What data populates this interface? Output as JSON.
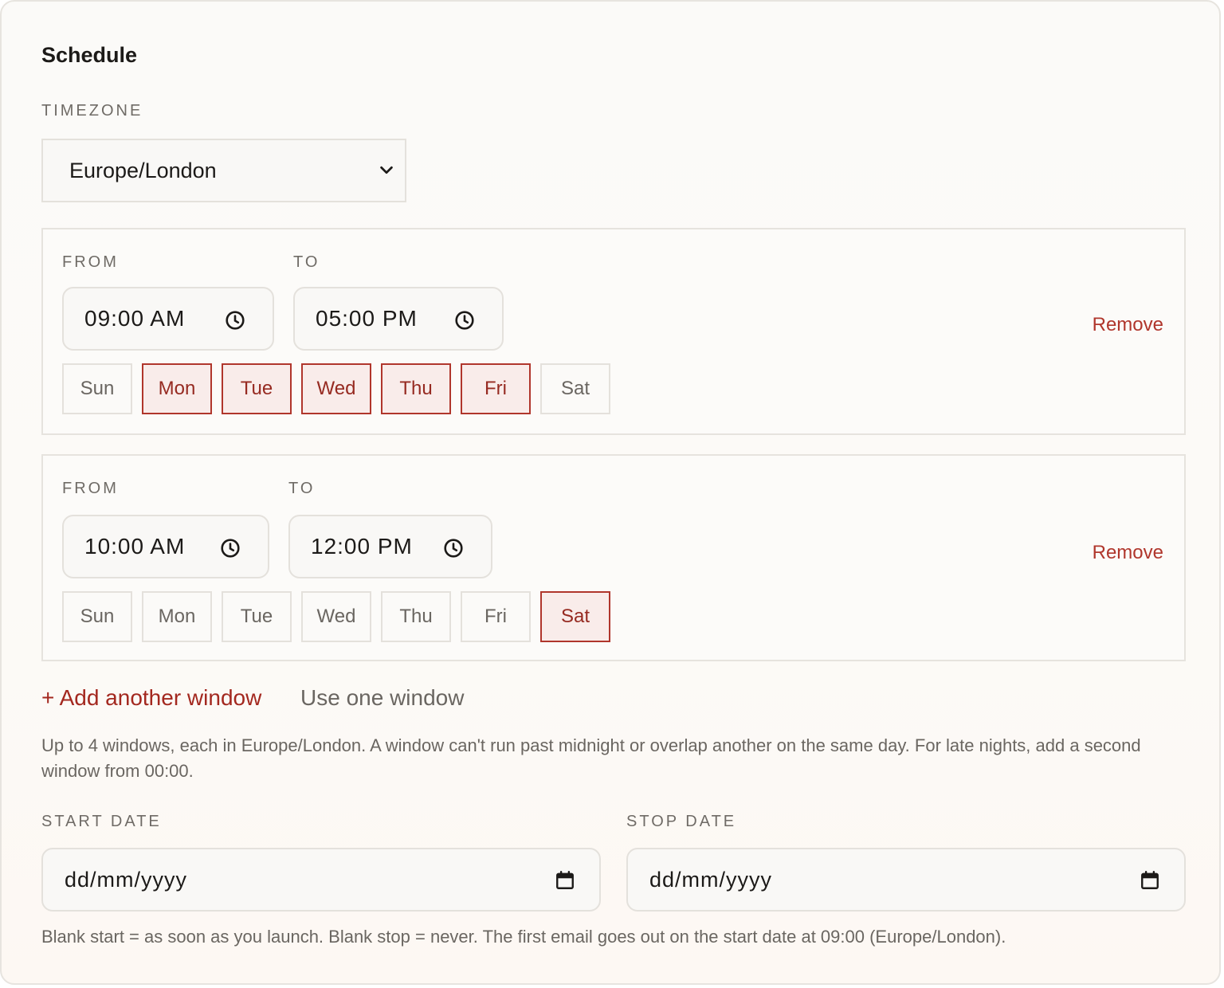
{
  "section": {
    "title": "Schedule"
  },
  "timezone": {
    "label": "TIMEZONE",
    "value": "Europe/London"
  },
  "windows": [
    {
      "from_label": "FROM",
      "to_label": "TO",
      "from": "09:00 AM",
      "to": "05:00 PM",
      "remove_label": "Remove",
      "days": [
        {
          "label": "Sun",
          "selected": false
        },
        {
          "label": "Mon",
          "selected": true
        },
        {
          "label": "Tue",
          "selected": true
        },
        {
          "label": "Wed",
          "selected": true
        },
        {
          "label": "Thu",
          "selected": true
        },
        {
          "label": "Fri",
          "selected": true
        },
        {
          "label": "Sat",
          "selected": false
        }
      ]
    },
    {
      "from_label": "FROM",
      "to_label": "TO",
      "from": "10:00 AM",
      "to": "12:00 PM",
      "remove_label": "Remove",
      "days": [
        {
          "label": "Sun",
          "selected": false
        },
        {
          "label": "Mon",
          "selected": false
        },
        {
          "label": "Tue",
          "selected": false
        },
        {
          "label": "Wed",
          "selected": false
        },
        {
          "label": "Thu",
          "selected": false
        },
        {
          "label": "Fri",
          "selected": false
        },
        {
          "label": "Sat",
          "selected": true
        }
      ]
    }
  ],
  "actions": {
    "add_window": "+ Add another window",
    "use_one": "Use one window"
  },
  "windows_help": "Up to 4 windows, each in Europe/London. A window can't run past midnight or overlap another on the same day. For late nights, add a second window from 00:00.",
  "start_date": {
    "label": "START DATE",
    "value": "dd/mm/yyyy"
  },
  "stop_date": {
    "label": "STOP DATE",
    "value": "dd/mm/yyyy"
  },
  "dates_help": "Blank start = as soon as you launch. Blank stop = never. The first email goes out on the start date at 09:00 (Europe/London).",
  "colors": {
    "accent": "#b0362c",
    "accent_bg": "#f9ecea",
    "border": "#e4e1dc"
  },
  "icons": {
    "select": "chevron-down-icon",
    "time": "clock-icon",
    "date": "calendar-icon"
  }
}
